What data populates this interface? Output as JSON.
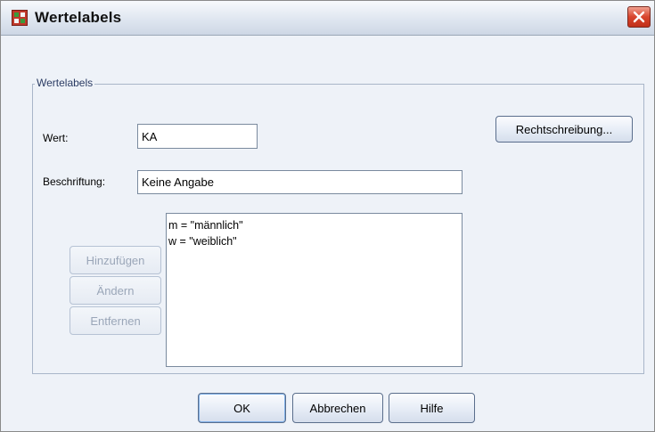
{
  "window": {
    "title": "Wertelabels"
  },
  "group": {
    "legend": "Wertelabels"
  },
  "form": {
    "value_label": "Wert:",
    "value_text": "KA",
    "caption_label": "Beschriftung:",
    "caption_text": "Keine Angabe"
  },
  "list": {
    "items": [
      "m = \"männlich\"",
      "w = \"weiblich\""
    ]
  },
  "buttons": {
    "spelling": "Rechtschreibung...",
    "add": "Hinzufügen",
    "change": "Ändern",
    "remove": "Entfernen",
    "ok": "OK",
    "cancel": "Abbrechen",
    "help": "Hilfe"
  },
  "icons": {
    "app": "spss-data-grid-icon",
    "close": "close-icon"
  },
  "colors": {
    "close_red": "#d8442c",
    "title_icon_red": "#c0392b",
    "title_icon_green": "#3a9a3a"
  }
}
